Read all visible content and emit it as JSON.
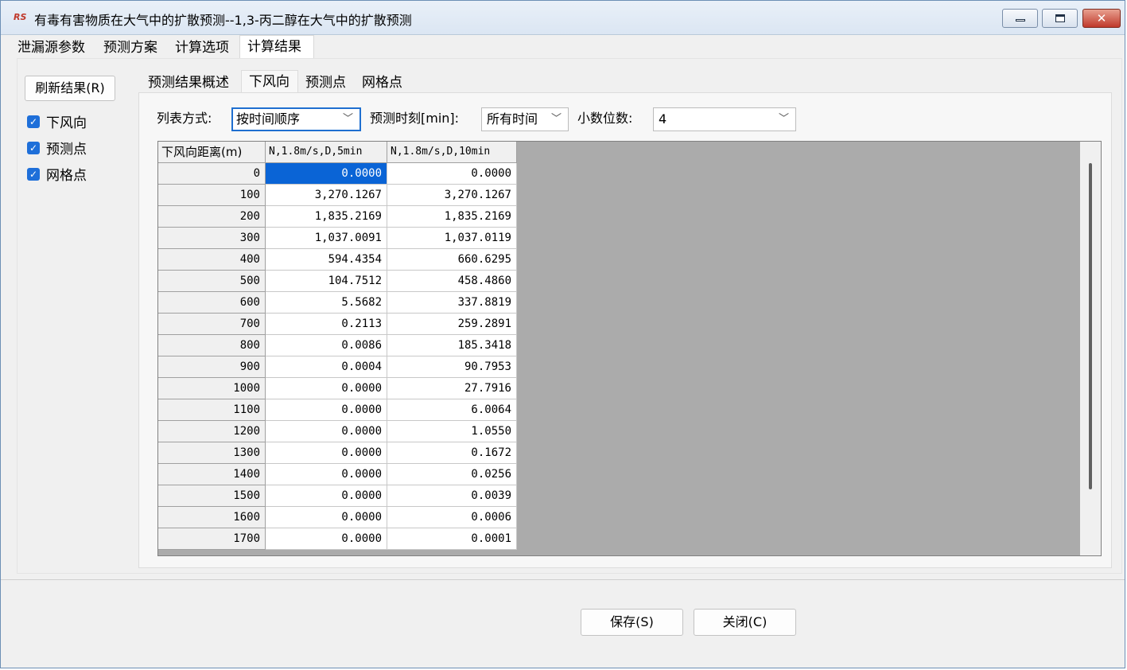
{
  "window": {
    "title": "有毒有害物质在大气中的扩散预测--1,3-丙二醇在大气中的扩散预测",
    "app_icon_text": "RS",
    "buttons": {
      "close_glyph": "✕"
    }
  },
  "main_tabs": [
    {
      "label": "泄漏源参数",
      "active": false
    },
    {
      "label": "预测方案",
      "active": false
    },
    {
      "label": "计算选项",
      "active": false
    },
    {
      "label": "计算结果",
      "active": true
    }
  ],
  "sidebar": {
    "refresh_label": "刷新结果(R)",
    "checkboxes": [
      {
        "label": "下风向",
        "checked": true
      },
      {
        "label": "预测点",
        "checked": true
      },
      {
        "label": "网格点",
        "checked": true
      }
    ],
    "check_glyph": "✓"
  },
  "sub_tabs": [
    {
      "label": "预测结果概述",
      "active": false
    },
    {
      "label": "下风向",
      "active": true
    },
    {
      "label": "预测点",
      "active": false
    },
    {
      "label": "网格点",
      "active": false
    }
  ],
  "filters": {
    "list_mode_label": "列表方式:",
    "list_mode_value": "按时间顺序",
    "time_label": "预测时刻[min]:",
    "time_value": "所有时间",
    "decimals_label": "小数位数:",
    "decimals_value": "4",
    "arrow_glyph": "﹀"
  },
  "grid": {
    "headers": [
      "下风向距离(m)",
      "N,1.8m/s,D,5min",
      "N,1.8m/s,D,10min"
    ],
    "rows": [
      [
        "0",
        "0.0000",
        "0.0000"
      ],
      [
        "100",
        "3,270.1267",
        "3,270.1267"
      ],
      [
        "200",
        "1,835.2169",
        "1,835.2169"
      ],
      [
        "300",
        "1,037.0091",
        "1,037.0119"
      ],
      [
        "400",
        "594.4354",
        "660.6295"
      ],
      [
        "500",
        "104.7512",
        "458.4860"
      ],
      [
        "600",
        "5.5682",
        "337.8819"
      ],
      [
        "700",
        "0.2113",
        "259.2891"
      ],
      [
        "800",
        "0.0086",
        "185.3418"
      ],
      [
        "900",
        "0.0004",
        "90.7953"
      ],
      [
        "1000",
        "0.0000",
        "27.7916"
      ],
      [
        "1100",
        "0.0000",
        "6.0064"
      ],
      [
        "1200",
        "0.0000",
        "1.0550"
      ],
      [
        "1300",
        "0.0000",
        "0.1672"
      ],
      [
        "1400",
        "0.0000",
        "0.0256"
      ],
      [
        "1500",
        "0.0000",
        "0.0039"
      ],
      [
        "1600",
        "0.0000",
        "0.0006"
      ],
      [
        "1700",
        "0.0000",
        "0.0001"
      ]
    ]
  },
  "footer": {
    "save_label": "保存(S)",
    "close_label": "关闭(C)"
  },
  "colors": {
    "selection": "#0a64d6",
    "checkbox": "#1e6fd9",
    "grid_background": "#ababab",
    "close_button": "#c0392b"
  }
}
